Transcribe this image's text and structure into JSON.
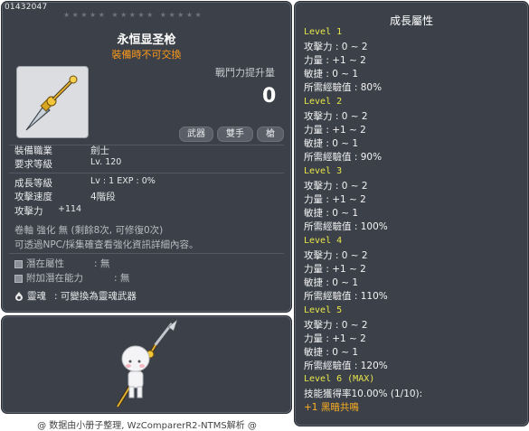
{
  "item": {
    "id": "01432047",
    "stars": "★★★★★  ★★★★★  ★★★★★",
    "name": "永恒显圣枪",
    "subtitle": "裝備時不可交換",
    "power_label": "戰鬥力提升量",
    "power_value": "0",
    "tags": [
      "武器",
      "雙手",
      "槍"
    ],
    "req": [
      {
        "label": "裝備職業",
        "value": "劍士"
      },
      {
        "label": "要求等級",
        "value": "Lv. 120"
      }
    ],
    "growth_level_label": "成長等級",
    "growth_level_value": "Lv : 1   EXP : 0%",
    "attack_speed_label": "攻擊速度",
    "attack_speed_value": "4階段",
    "attack_label": "攻擊力",
    "attack_value": "+114",
    "scroll_text": "卷軸 強化 無 (剩餘8次, 可修復0次)",
    "scroll_note": "可透過NPC/採集確查看強化資訊詳細內容。",
    "potential_label": "潛在屬性",
    "potential_value": ": 無",
    "bonus_potential_label": "附加潛在能力",
    "bonus_potential_value": ": 無",
    "soul_label": "靈魂",
    "soul_value": ": 可變換為靈魂武器"
  },
  "growth": {
    "title": "成長屬性",
    "levels": [
      {
        "name": "Level 1",
        "atk": "攻擊力 : 0 ~ 2",
        "str": "力量 : +1 ~ 2",
        "dex": "敏捷 : 0 ~ 1",
        "exp": "所需經驗值 : 80%"
      },
      {
        "name": "Level 2",
        "atk": "攻擊力 : 0 ~ 2",
        "str": "力量 : +1 ~ 2",
        "dex": "敏捷 : 0 ~ 1",
        "exp": "所需經驗值 : 90%"
      },
      {
        "name": "Level 3",
        "atk": "攻擊力 : 0 ~ 2",
        "str": "力量 : +1 ~ 2",
        "dex": "敏捷 : 0 ~ 1",
        "exp": "所需經驗值 : 100%"
      },
      {
        "name": "Level 4",
        "atk": "攻擊力 : 0 ~ 2",
        "str": "力量 : +1 ~ 2",
        "dex": "敏捷 : 0 ~ 1",
        "exp": "所需經驗值 : 110%"
      },
      {
        "name": "Level 5",
        "atk": "攻擊力 : 0 ~ 2",
        "str": "力量 : +1 ~ 2",
        "dex": "敏捷 : 0 ~ 1",
        "exp": "所需經驗值 : 120%"
      }
    ],
    "max_level": "Level 6 (MAX)",
    "skill_rate": "技能獲得率10.00% (1/10):",
    "skill_bonus": "+1 黑暗共鳴"
  },
  "footer": "@ 数据由小册子整理, WzComparerR2-NTMS解析 @",
  "colors": {
    "panel": "#3c4149",
    "accent_orange": "#ff9a1a",
    "level_yellow": "#e8e64a"
  }
}
